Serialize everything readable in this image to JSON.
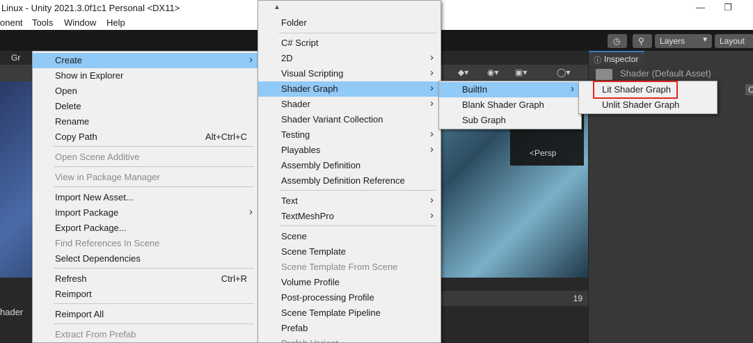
{
  "window": {
    "title": "Linux - Unity 2021.3.0f1c1 Personal <DX11>",
    "restore_icon": "restore-icon"
  },
  "menubar": {
    "items": [
      "onent",
      "Tools",
      "Window",
      "Help"
    ]
  },
  "toolbar": {
    "layers_label": "Layers",
    "layout_label": "Layout",
    "history_icon": "history-icon",
    "search_icon": "search-icon"
  },
  "scene": {
    "tab_partial": "Gr",
    "persp_label": "<Persp",
    "project_count": "19",
    "shader_tab_partial": "hader"
  },
  "inspector": {
    "tab_label": "Inspector",
    "asset_title": "Shader (Default Asset)",
    "partial_button": "C"
  },
  "menu1": {
    "items": [
      {
        "label": "Create",
        "arrow": true,
        "highlighted": true
      },
      {
        "label": "Show in Explorer"
      },
      {
        "label": "Open"
      },
      {
        "label": "Delete"
      },
      {
        "label": "Rename"
      },
      {
        "label": "Copy Path",
        "shortcut": "Alt+Ctrl+C"
      },
      {
        "label": "Open Scene Additive",
        "disabled": true
      },
      {
        "label": "View in Package Manager",
        "disabled": true
      },
      {
        "label": "Import New Asset..."
      },
      {
        "label": "Import Package",
        "arrow": true
      },
      {
        "label": "Export Package..."
      },
      {
        "label": "Find References In Scene",
        "disabled": true
      },
      {
        "label": "Select Dependencies"
      },
      {
        "label": "Refresh",
        "shortcut": "Ctrl+R"
      },
      {
        "label": "Reimport"
      },
      {
        "label": "Reimport All"
      },
      {
        "label": "Extract From Prefab",
        "disabled": true
      }
    ]
  },
  "menu2": {
    "scroll_up_icon": "scroll-up-icon",
    "items": [
      {
        "label": "Folder"
      },
      {
        "label": "C# Script"
      },
      {
        "label": "2D",
        "arrow": true
      },
      {
        "label": "Visual Scripting",
        "arrow": true
      },
      {
        "label": "Shader Graph",
        "arrow": true,
        "highlighted": true
      },
      {
        "label": "Shader",
        "arrow": true
      },
      {
        "label": "Shader Variant Collection"
      },
      {
        "label": "Testing",
        "arrow": true
      },
      {
        "label": "Playables",
        "arrow": true
      },
      {
        "label": "Assembly Definition"
      },
      {
        "label": "Assembly Definition Reference"
      },
      {
        "label": "Text",
        "arrow": true
      },
      {
        "label": "TextMeshPro",
        "arrow": true
      },
      {
        "label": "Scene"
      },
      {
        "label": "Scene Template"
      },
      {
        "label": "Scene Template From Scene",
        "disabled": true
      },
      {
        "label": "Volume Profile"
      },
      {
        "label": "Post-processing Profile"
      },
      {
        "label": "Scene Template Pipeline"
      },
      {
        "label": "Prefab"
      },
      {
        "label": "Prefab Variant",
        "disabled": true
      }
    ]
  },
  "menu3": {
    "items": [
      {
        "label": "BuiltIn",
        "arrow": true,
        "highlighted": true
      },
      {
        "label": "Blank Shader Graph"
      },
      {
        "label": "Sub Graph"
      }
    ]
  },
  "menu4": {
    "items": [
      {
        "label": "Lit Shader Graph",
        "boxed": true
      },
      {
        "label": "Unlit Shader Graph"
      }
    ]
  },
  "colors": {
    "highlight": "#91c9f7",
    "menu_bg": "#f0f0f0",
    "annotation_box": "#e0291f",
    "inspector_tab_accent": "#3a79bb"
  }
}
